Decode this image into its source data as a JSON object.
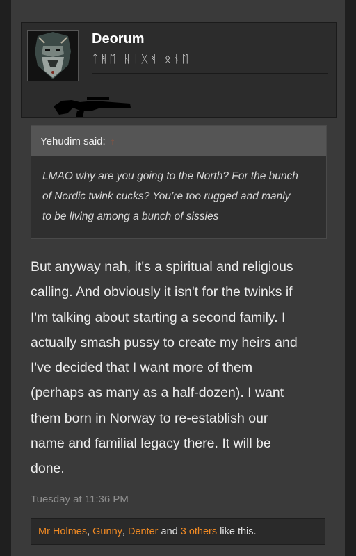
{
  "user": {
    "name": "Deorum",
    "title": "ᛏᚻᛖ ᚺᛁᚷᚻ ᛟᚾᛖ",
    "avatar_icon": "bearded-warrior-avatar-icon",
    "banner_icon": "rifle-silhouette-icon"
  },
  "quote": {
    "author_label": "Yehudim said:",
    "arrow_icon": "up-arrow-icon",
    "lines": [
      "LMAO why are you going to the North? For the bunch",
      "of Nordic twink cucks? You’re too rugged and manly",
      "to be living among a bunch of sissies"
    ]
  },
  "message": {
    "lines": [
      "But anyway nah, it's a spiritual and religious",
      "calling. And obviously it isn't for the twinks if",
      "I'm talking about starting a second family. I",
      "actually smash pussy to create my heirs and",
      "I've decided that I want more of them",
      "(perhaps as many as a half-dozen). I want",
      "them born in Norway to re-establish our",
      "name and familial legacy there. It will be",
      "done."
    ]
  },
  "timestamp": "Tuesday at 11:36 PM",
  "likes": {
    "user1": "Mr Holmes",
    "sep1": ", ",
    "user2": "Gunny",
    "sep2": ", ",
    "user3": "Denter",
    "and": " and ",
    "others": "3 others",
    "suffix": " like this."
  },
  "colors": {
    "link": "#f08a24",
    "quote_arrow": "#e05020",
    "post_bg": "#3a3a3a"
  }
}
